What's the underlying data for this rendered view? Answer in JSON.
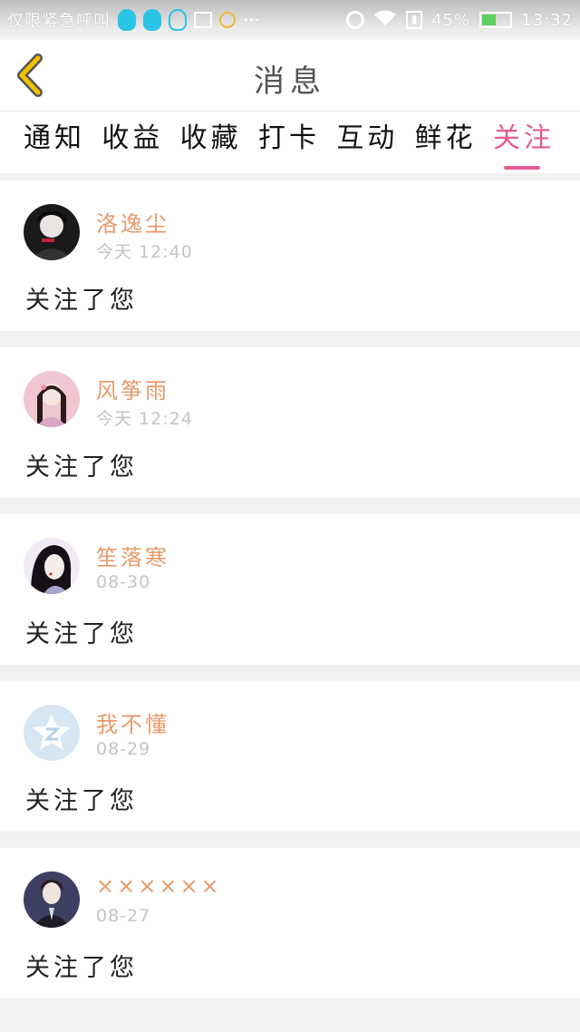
{
  "status_bar": {
    "carrier": "仅限紧急呼叫",
    "battery_percent": "45%",
    "battery_level": 0.45,
    "time": "13:32",
    "icons": [
      "qq-icon",
      "qq-icon",
      "qq-outline-icon",
      "image-icon",
      "bulb-icon",
      "more-dots-icon",
      "alarm-icon",
      "wifi-icon",
      "sim-icon",
      "battery-icon"
    ]
  },
  "header": {
    "back_icon": "chevron-left-icon",
    "title": "消息",
    "accent_color": "#f2c200"
  },
  "tabs": [
    {
      "label": "通知",
      "active": false
    },
    {
      "label": "收益",
      "active": false
    },
    {
      "label": "收藏",
      "active": false
    },
    {
      "label": "打卡",
      "active": false
    },
    {
      "label": "互动",
      "active": false
    },
    {
      "label": "鲜花",
      "active": false
    },
    {
      "label": "关注",
      "active": true
    }
  ],
  "colors": {
    "active_tab": "#e55a95",
    "username": "#e89a6a",
    "timestamp": "#c4c4c4"
  },
  "notifications": [
    {
      "username": "洛逸尘",
      "time": "今天 12:40",
      "message": "关注了您",
      "avatar": "avatar-dark-boy"
    },
    {
      "username": "风筝雨",
      "time": "今天 12:24",
      "message": "关注了您",
      "avatar": "avatar-pink-girl"
    },
    {
      "username": "笙落寒",
      "time": "08-30",
      "message": "关注了您",
      "avatar": "avatar-anime-girl"
    },
    {
      "username": "我不懂",
      "time": "08-29",
      "message": "关注了您",
      "avatar": "avatar-default-logo"
    },
    {
      "username": "××××××",
      "time": "08-27",
      "message": "关注了您",
      "avatar": "avatar-suit-boy"
    }
  ]
}
